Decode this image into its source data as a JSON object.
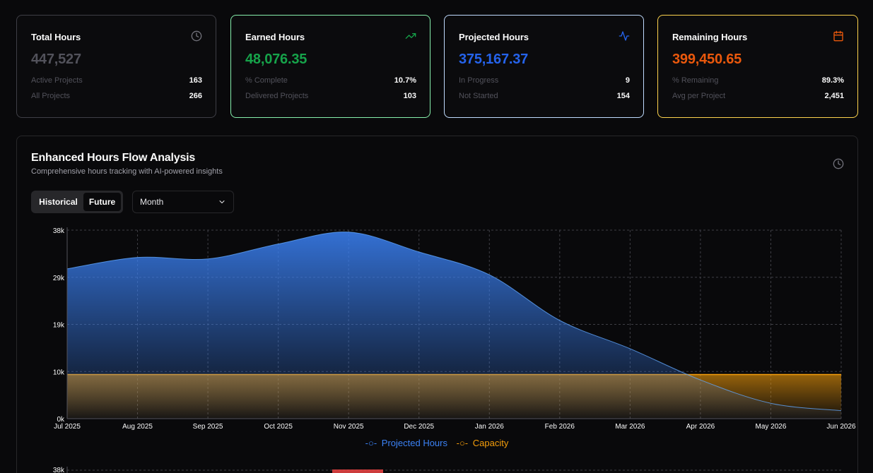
{
  "cards": [
    {
      "title": "Total Hours",
      "value": "447,527",
      "icon": "clock-icon",
      "rows": [
        {
          "label": "Active Projects",
          "value": "163"
        },
        {
          "label": "All Projects",
          "value": "266"
        }
      ]
    },
    {
      "title": "Earned Hours",
      "value": "48,076.35",
      "icon": "trending-up-icon",
      "rows": [
        {
          "label": "% Complete",
          "value": "10.7%"
        },
        {
          "label": "Delivered Projects",
          "value": "103"
        }
      ]
    },
    {
      "title": "Projected Hours",
      "value": "375,167.37",
      "icon": "activity-icon",
      "rows": [
        {
          "label": "In Progress",
          "value": "9"
        },
        {
          "label": "Not Started",
          "value": "154"
        }
      ]
    },
    {
      "title": "Remaining Hours",
      "value": "399,450.65",
      "icon": "calendar-icon",
      "rows": [
        {
          "label": "% Remaining",
          "value": "89.3%"
        },
        {
          "label": "Avg per Project",
          "value": "2,451"
        }
      ]
    }
  ],
  "panel": {
    "title": "Enhanced Hours Flow Analysis",
    "subtitle": "Comprehensive hours tracking with AI-powered insights",
    "toggle": {
      "historical": "Historical",
      "future": "Future",
      "selected": "Future"
    },
    "period_select": {
      "value": "Month"
    }
  },
  "colors": {
    "projected": "#3b82f6",
    "capacity": "#f59e0b",
    "earned": "#16a34a",
    "remaining": "#ea580c"
  },
  "chart_data": {
    "type": "area",
    "categories": [
      "Jul 2025",
      "Aug 2025",
      "Sep 2025",
      "Oct 2025",
      "Nov 2025",
      "Dec 2025",
      "Jan 2026",
      "Feb 2026",
      "Mar 2026",
      "Apr 2026",
      "May 2026",
      "Jun 2026"
    ],
    "y_ticks": [
      "0k",
      "10k",
      "19k",
      "29k",
      "38k"
    ],
    "ylim": [
      0,
      38000
    ],
    "grid": true,
    "legend_position": "bottom",
    "series": [
      {
        "name": "Projected Hours",
        "values": [
          30200,
          32500,
          32200,
          35200,
          37600,
          33600,
          29000,
          19800,
          14100,
          7800,
          3100,
          1600
        ]
      },
      {
        "name": "Capacity",
        "values": [
          8900,
          8900,
          8900,
          8900,
          8900,
          8900,
          8900,
          8900,
          8900,
          8900,
          8900,
          8900
        ]
      }
    ]
  },
  "second_chart_first_tick": "38k"
}
